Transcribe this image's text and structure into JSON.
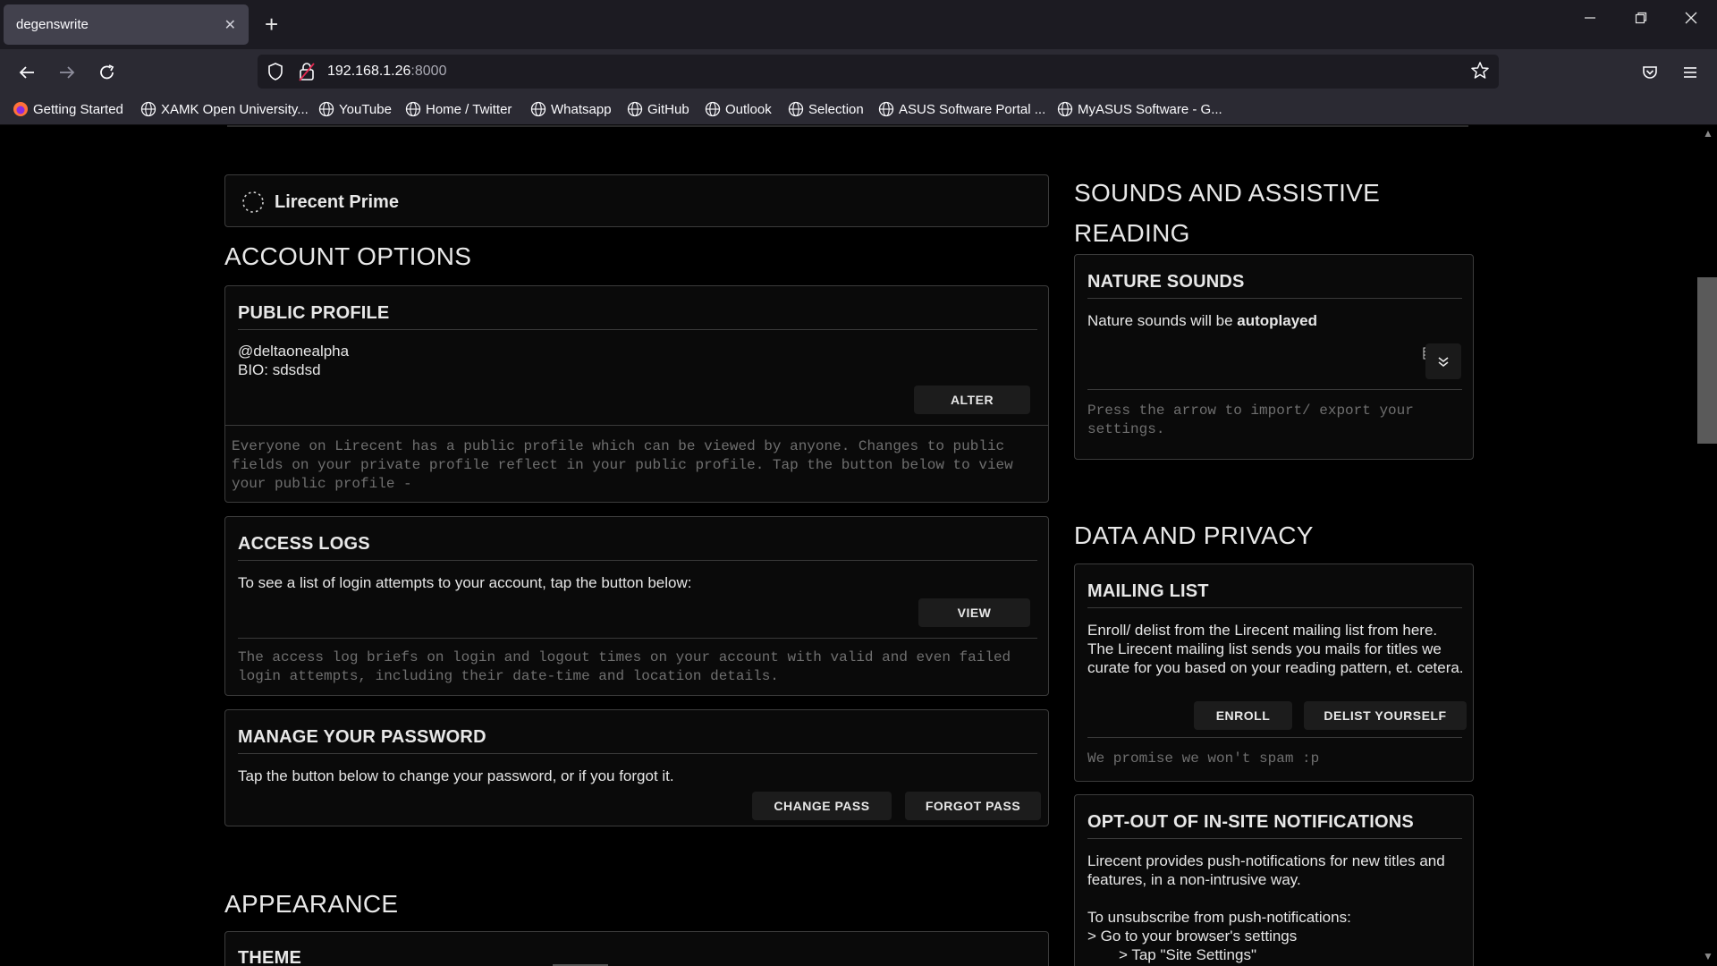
{
  "browser": {
    "tab_title": "degenswrite",
    "tab_close": "✕",
    "new_tab": "+",
    "url_host": "192.168.1.26",
    "url_port": ":8000",
    "bookmarks": [
      "Getting Started",
      "XAMK Open University...",
      "YouTube",
      "Home / Twitter",
      "Whatsapp",
      "GitHub",
      "Outlook",
      "Selection",
      "ASUS Software Portal ...",
      "MyASUS Software - G..."
    ]
  },
  "prime": {
    "label": "Lirecent Prime"
  },
  "account": {
    "title": "ACCOUNT OPTIONS",
    "public_profile": {
      "title": "PUBLIC PROFILE",
      "handle": "@deltaonealpha",
      "bio": "BIO: sdsdsd",
      "button": "ALTER",
      "note": "Everyone on Lirecent has a public profile which can be viewed by anyone. Changes to public fields on your private profile reflect in your public profile. Tap the button below to view your public profile -"
    },
    "access_logs": {
      "title": "ACCESS LOGS",
      "text": "To see a list of login attempts to your account, tap the button below:",
      "button": "VIEW",
      "note": "The access log briefs on login and logout times on your account with valid and even failed login attempts, including their date-time and location details."
    },
    "password": {
      "title": "MANAGE YOUR PASSWORD",
      "text": "Tap the button below to change your password, or if you forgot it.",
      "change_button": "CHANGE PASS",
      "forgot_button": "FORGOT PASS"
    }
  },
  "appearance": {
    "title": "APPEARANCE",
    "theme_title": "THEME"
  },
  "sounds": {
    "title_line1": "SOUNDS AND ASSISTIVE",
    "title_line2": "READING",
    "nature": {
      "title": "NATURE SOUNDS",
      "text_prefix": "Nature sounds will be ",
      "text_bold": "autoplayed",
      "note": "Press the arrow to import/ export your settings."
    }
  },
  "privacy": {
    "title": "DATA AND PRIVACY",
    "mailing": {
      "title": "MAILING LIST",
      "text": "Enroll/ delist from the Lirecent mailing list from here. The Lirecent mailing list sends you mails for titles we curate for you based on your reading pattern, et. cetera.",
      "enroll_button": "ENROLL",
      "delist_button": "DELIST YOURSELF",
      "note": "We promise we won't spam :p"
    },
    "optout": {
      "title": "OPT-OUT OF IN-SITE NOTIFICATIONS",
      "text1": "Lirecent provides push-notifications for new titles and features, in a non-intrusive way.",
      "text2": "To unsubscribe from push-notifications:",
      "step1": "> Go to your browser's settings",
      "step2": "> Tap \"Site Settings\""
    }
  }
}
